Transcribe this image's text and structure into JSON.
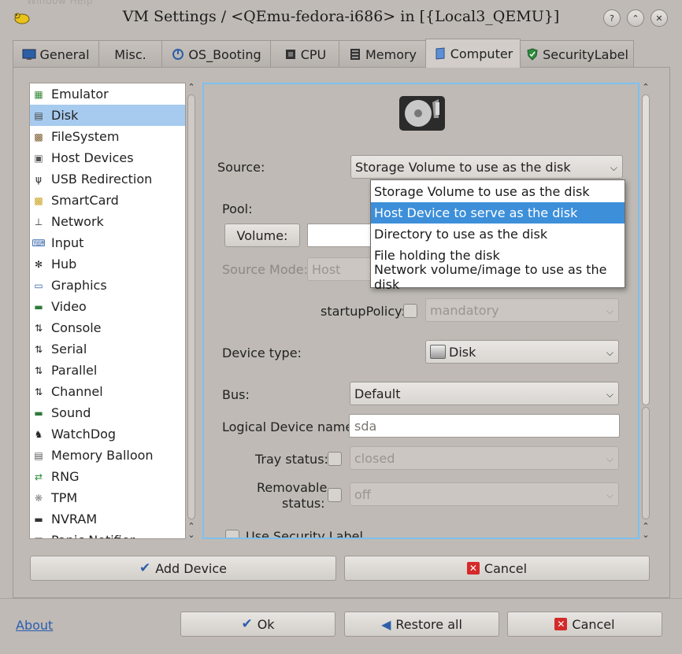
{
  "window": {
    "menu_ghost": "Window  Help",
    "title": "VM Settings / <QEmu-fedora-i686> in [{Local3_QEMU}]"
  },
  "tabs": [
    {
      "label": "General",
      "icon": "monitor-icon"
    },
    {
      "label": "Misc.",
      "icon": ""
    },
    {
      "label": "OS_Booting",
      "icon": "boot-icon"
    },
    {
      "label": "CPU",
      "icon": "cpu-icon"
    },
    {
      "label": "Memory",
      "icon": "memory-icon"
    },
    {
      "label": "Computer",
      "icon": "computer-icon"
    },
    {
      "label": "SecurityLabel",
      "icon": "shield-icon"
    }
  ],
  "devices": [
    {
      "label": "Emulator",
      "icon": "emulator-icon"
    },
    {
      "label": "Disk",
      "icon": "disk-icon"
    },
    {
      "label": "FileSystem",
      "icon": "filesystem-icon"
    },
    {
      "label": "Host Devices",
      "icon": "host-devices-icon"
    },
    {
      "label": "USB Redirection",
      "icon": "usb-icon"
    },
    {
      "label": "SmartCard",
      "icon": "smartcard-icon"
    },
    {
      "label": "Network",
      "icon": "network-icon"
    },
    {
      "label": "Input",
      "icon": "input-icon"
    },
    {
      "label": "Hub",
      "icon": "hub-icon"
    },
    {
      "label": "Graphics",
      "icon": "graphics-icon"
    },
    {
      "label": "Video",
      "icon": "video-icon"
    },
    {
      "label": "Console",
      "icon": "console-icon"
    },
    {
      "label": "Serial",
      "icon": "serial-icon"
    },
    {
      "label": "Parallel",
      "icon": "parallel-icon"
    },
    {
      "label": "Channel",
      "icon": "channel-icon"
    },
    {
      "label": "Sound",
      "icon": "sound-icon"
    },
    {
      "label": "WatchDog",
      "icon": "watchdog-icon"
    },
    {
      "label": "Memory Balloon",
      "icon": "memory-balloon-icon"
    },
    {
      "label": "RNG",
      "icon": "rng-icon"
    },
    {
      "label": "TPM",
      "icon": "tpm-icon"
    },
    {
      "label": "NVRAM",
      "icon": "nvram-icon"
    },
    {
      "label": "Panic Notifier",
      "icon": "panic-icon"
    }
  ],
  "disk": {
    "source_label": "Source:",
    "source_value": "Storage Volume to use as the disk",
    "source_options": [
      "Storage Volume to use as the disk",
      "Host Device to serve as the disk",
      "Directory to use as the disk",
      "File holding the disk",
      "Network volume/image to use as the disk"
    ],
    "pool_label": "Pool:",
    "volume_button": "Volume:",
    "volume_value": "",
    "source_mode_label": "Source Mode:",
    "source_mode_value": "Host",
    "startup_policy_label": "startupPolicy:",
    "startup_policy_value": "mandatory",
    "device_type_label": "Device type:",
    "device_type_value": "Disk",
    "bus_label": "Bus:",
    "bus_value": "Default",
    "logical_name_label": "Logical Device name:",
    "logical_name_placeholder": "sda",
    "tray_label": "Tray status:",
    "tray_value": "closed",
    "removable_label_1": "Removable",
    "removable_label_2": "status:",
    "removable_value": "off",
    "security_label": "Use Security Label"
  },
  "actions": {
    "add_device": "Add Device",
    "cancel": "Cancel"
  },
  "footer": {
    "about": "About",
    "ok": "Ok",
    "restore_all": "Restore all",
    "cancel": "Cancel"
  }
}
